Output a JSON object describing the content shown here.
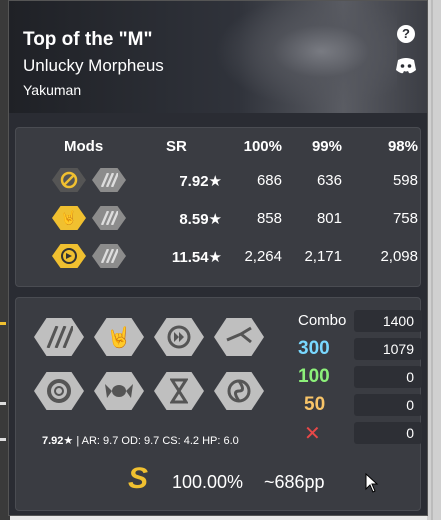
{
  "beatmap": {
    "title": "Top of the \"M\"",
    "artist": "Unlucky Morpheus",
    "mapper": "Yakuman"
  },
  "pp_table": {
    "headers": {
      "mods": "Mods",
      "sr": "SR",
      "acc100": "100%",
      "acc99": "99%",
      "acc98": "98%"
    },
    "rows": [
      {
        "mod_icons": [
          "nofail-icon",
          "hardrock-icon"
        ],
        "sr": "7.92★",
        "pp100": "686",
        "pp99": "636",
        "pp98": "598"
      },
      {
        "mod_icons": [
          "doubletime-icon",
          "hardrock-icon"
        ],
        "sr": "8.59★",
        "pp100": "858",
        "pp99": "801",
        "pp98": "758"
      },
      {
        "mod_icons": [
          "flashlight-icon",
          "hardrock-icon"
        ],
        "sr": "11.54★",
        "pp100": "2,264",
        "pp99": "2,171",
        "pp98": "2,098"
      }
    ]
  },
  "mods": {
    "buttons": [
      {
        "name": "hardrock-mod",
        "icon": "stripes-icon"
      },
      {
        "name": "doubletime-mod",
        "icon": "rock-hand-icon"
      },
      {
        "name": "fastforward-mod",
        "icon": "fast-forward-icon"
      },
      {
        "name": "flashlight-mod",
        "icon": "flashlight-icon"
      },
      {
        "name": "nofail-mod",
        "icon": "lifebuoy-icon"
      },
      {
        "name": "easy-mod",
        "icon": "candy-icon"
      },
      {
        "name": "halftime-mod",
        "icon": "hourglass-icon"
      },
      {
        "name": "spunout-mod",
        "icon": "spiral-icon"
      }
    ],
    "stats": {
      "sr": "7.92★",
      "details": "| AR: 9.7  OD: 9.7  CS: 4.2  HP: 6.0"
    }
  },
  "judgements": {
    "combo_label": "Combo",
    "combo_value": "1400",
    "n300_label": "300",
    "n300_value": "1079",
    "n100_label": "100",
    "n100_value": "0",
    "n50_label": "50",
    "n50_value": "0",
    "miss_label": "✕",
    "miss_value": "0"
  },
  "result": {
    "rank": "S",
    "accuracy": "100.00%",
    "pp": "~686pp"
  },
  "colors": {
    "n300": "#79d8ff",
    "n100": "#8cf07a",
    "n50": "#f8c468",
    "miss": "#e84848",
    "accent": "#f0c030"
  }
}
